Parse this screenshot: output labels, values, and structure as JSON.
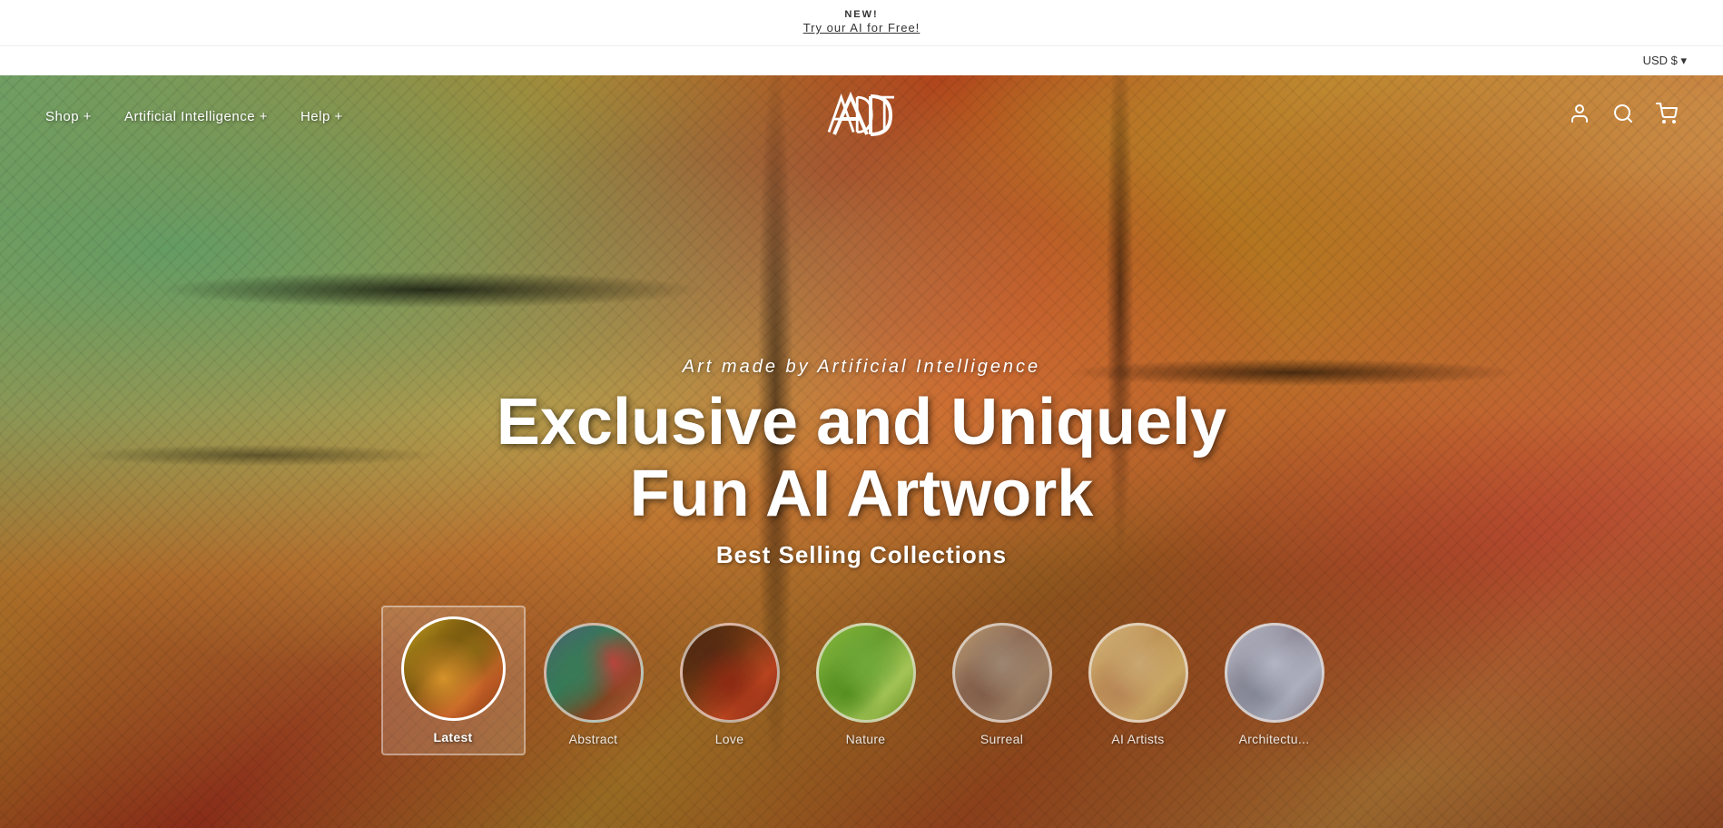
{
  "announcement": {
    "new_label": "NEW!",
    "link_text": "Try our AI for Free!"
  },
  "header": {
    "currency": "USD $",
    "currency_dropdown_label": "USD $ ▾",
    "nav_left": [
      {
        "id": "shop",
        "label": "Shop +"
      },
      {
        "id": "ai",
        "label": "Artificial Intelligence +"
      },
      {
        "id": "help",
        "label": "Help +"
      }
    ],
    "logo_alt": "ADT Logo",
    "nav_right": {
      "account_icon": "person",
      "search_icon": "search",
      "cart_icon": "cart"
    }
  },
  "hero": {
    "subtitle": "Art made by Artificial Intelligence",
    "title": "Exclusive and Uniquely\nFun AI Artwork",
    "tagline": "Best Selling Collections"
  },
  "collections": [
    {
      "id": "latest",
      "label": "Latest",
      "active": true
    },
    {
      "id": "abstract",
      "label": "Abstract",
      "active": false
    },
    {
      "id": "love",
      "label": "Love",
      "active": false
    },
    {
      "id": "nature",
      "label": "Nature",
      "active": false
    },
    {
      "id": "surreal",
      "label": "Surreal",
      "active": false
    },
    {
      "id": "ai-artists",
      "label": "AI Artists",
      "active": false
    },
    {
      "id": "architecture",
      "label": "Architectu...",
      "active": false
    }
  ]
}
